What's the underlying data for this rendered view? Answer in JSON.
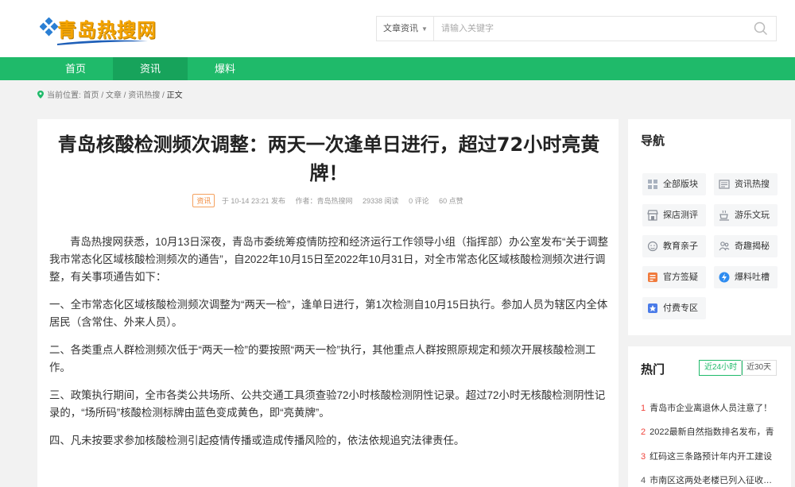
{
  "header": {
    "logo_text": "青岛热搜网",
    "search": {
      "category": "文章资讯",
      "placeholder": "请输入关键字"
    }
  },
  "nav": {
    "items": [
      {
        "label": "首页"
      },
      {
        "label": "资讯"
      },
      {
        "label": "爆料"
      }
    ],
    "active": "资讯"
  },
  "breadcrumb": {
    "prefix": "当前位置:",
    "path": "首页 / 文章 / 资讯热搜 /",
    "current": "正文"
  },
  "article": {
    "title": "青岛核酸检测频次调整：两天一次逢单日进行，超过72小时亮黄牌！",
    "tag": "资讯",
    "time": "于 10-14 23:21 发布",
    "author": "作者：青岛热搜网",
    "reads": "29338 阅读",
    "comments": "0 评论",
    "likes": "60 点赞",
    "paragraphs": [
      "青岛热搜网获悉，10月13日深夜，青岛市委统筹疫情防控和经济运行工作领导小组（指挥部）办公室发布“关于调整我市常态化区域核酸检测频次的通告”，自2022年10月15日至2022年10月31日，对全市常态化区域核酸检测频次进行调整，有关事项通告如下：",
      "一、全市常态化区域核酸检测频次调整为“两天一检”，逢单日进行，第1次检测自10月15日执行。参加人员为辖区内全体居民（含常住、外来人员）。",
      "二、各类重点人群检测频次低于“两天一检”的要按照“两天一检”执行，其他重点人群按照原规定和频次开展核酸检测工作。",
      "三、政策执行期间，全市各类公共场所、公共交通工具须查验72小时核酸检测阴性记录。超过72小时无核酸检测阴性记录的，“场所码”核酸检测标牌由蓝色变成黄色，即“亮黄牌”。",
      "四、凡未按要求参加核酸检测引起疫情传播或造成传播风险的，依法依规追究法律责任。"
    ]
  },
  "sidebar": {
    "nav_title": "导航",
    "categories": [
      {
        "label": "全部版块",
        "icon": "grid-icon",
        "color": "#9aa5b4"
      },
      {
        "label": "资讯热搜",
        "icon": "newspaper-icon",
        "color": "#8a8f99"
      },
      {
        "label": "探店测评",
        "icon": "store-icon",
        "color": "#8a8f99"
      },
      {
        "label": "游乐文玩",
        "icon": "teacup-icon",
        "color": "#8a8f99"
      },
      {
        "label": "教育亲子",
        "icon": "face-icon",
        "color": "#8a8f99"
      },
      {
        "label": "奇趣揭秘",
        "icon": "people-icon",
        "color": "#8a8f99"
      },
      {
        "label": "官方签疑",
        "icon": "checklist-icon",
        "color": "#f07a3c"
      },
      {
        "label": "爆料吐槽",
        "icon": "lightning-icon",
        "color": "#2f8cf0"
      },
      {
        "label": "付费专区",
        "icon": "premium-icon",
        "color": "#4a7be8"
      }
    ],
    "hot": {
      "title": "热门",
      "tabs": [
        "近24小时",
        "近30天"
      ],
      "active_tab": "近24小时",
      "items": [
        {
          "rank": "1",
          "text": "青岛市企业离退休人员注意了！"
        },
        {
          "rank": "2",
          "text": "2022最新自然指数排名发布，青"
        },
        {
          "rank": "3",
          "text": "红码这三条路预计年内开工建设"
        },
        {
          "rank": "4",
          "text": "市南区这两处老楼已列入征收计划"
        }
      ]
    }
  },
  "colors": {
    "brand_green": "#1fba6a",
    "nav_active": "#17a35b",
    "logo_orange": "#f5a400",
    "hot_rank_red": "#f0443c"
  }
}
